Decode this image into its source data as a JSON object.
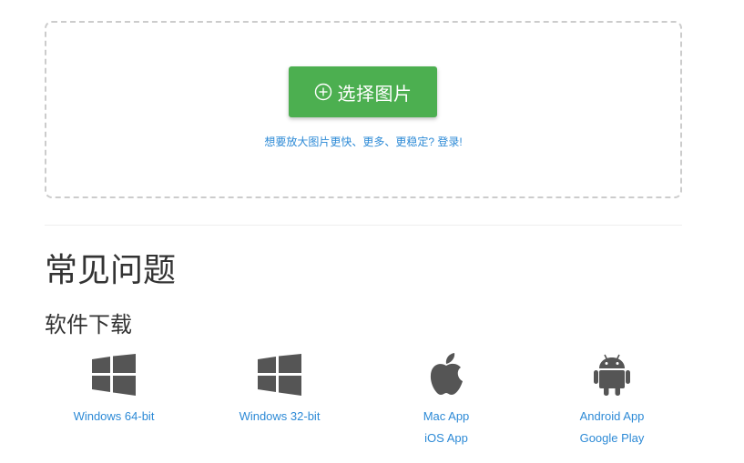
{
  "upload": {
    "button_label": "选择图片",
    "button_icon": "plus-circle-icon",
    "button_color": "#4caf50",
    "login_hint": "想要放大图片更快、更多、更稳定? 登录!"
  },
  "faq": {
    "title": "常见问题"
  },
  "downloads": {
    "title": "软件下载",
    "link_color": "#2d8ad6",
    "items": [
      {
        "icon": "windows-icon",
        "links": [
          "Windows 64-bit"
        ]
      },
      {
        "icon": "windows-icon",
        "links": [
          "Windows 32-bit"
        ]
      },
      {
        "icon": "apple-icon",
        "links": [
          "Mac App",
          "iOS App"
        ]
      },
      {
        "icon": "android-icon",
        "links": [
          "Android App",
          "Google Play"
        ]
      }
    ]
  }
}
